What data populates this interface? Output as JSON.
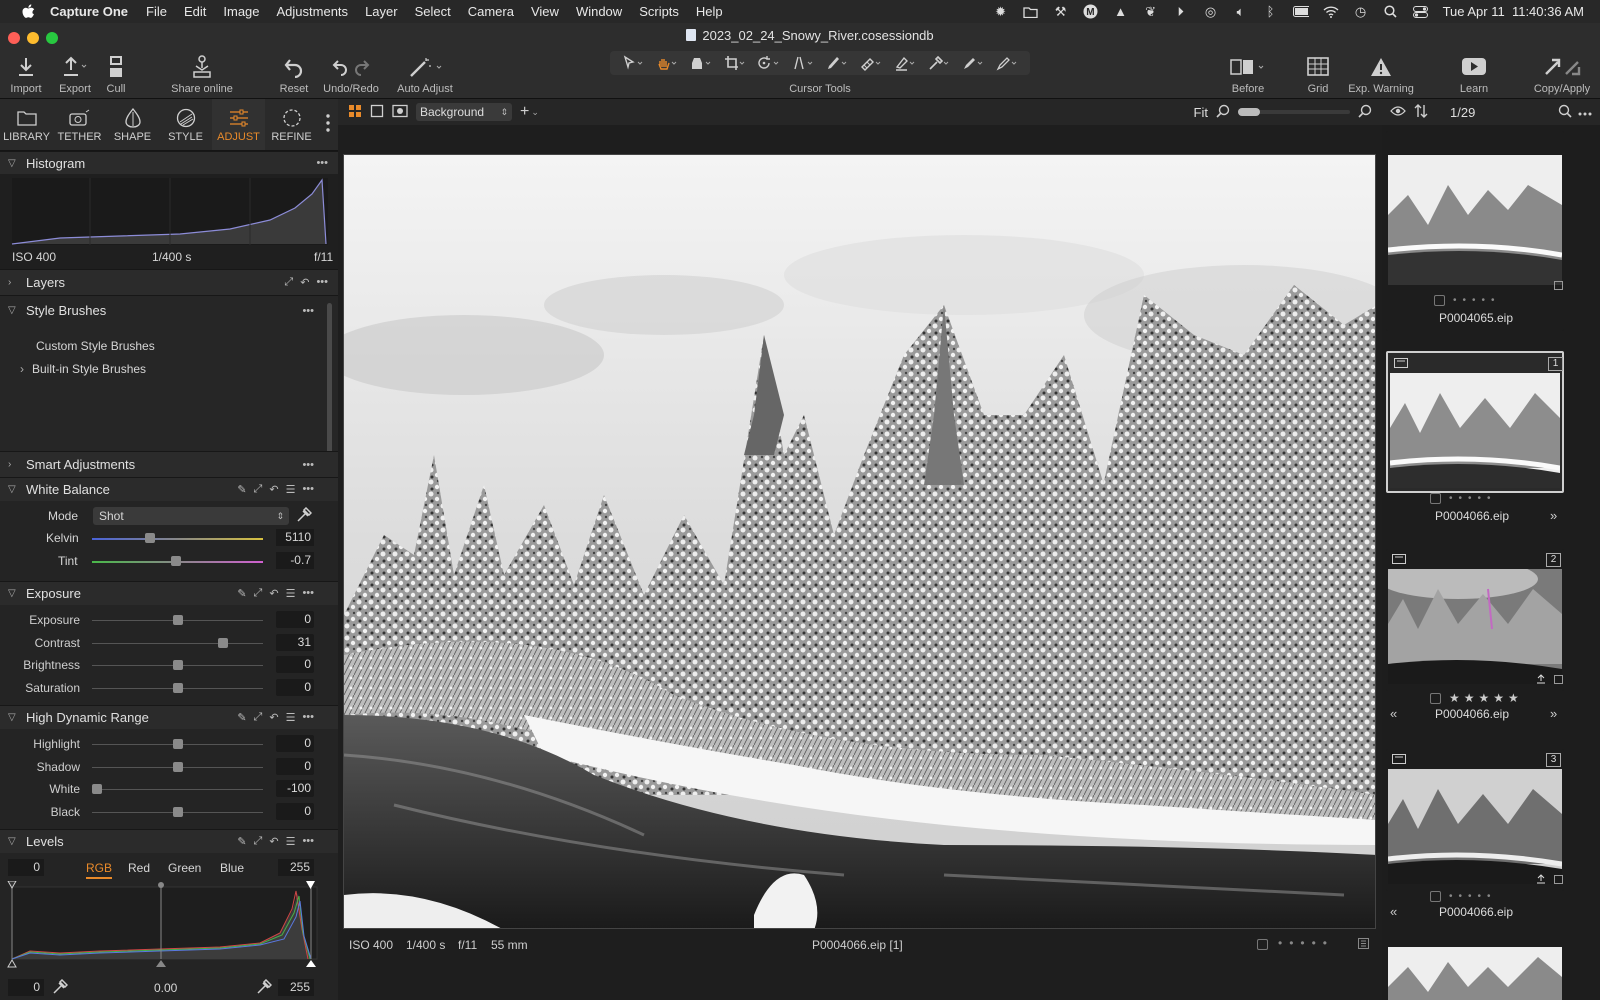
{
  "menubar": {
    "app": "Capture One",
    "items": [
      "File",
      "Edit",
      "Image",
      "Adjustments",
      "Layer",
      "Select",
      "Camera",
      "View",
      "Window",
      "Scripts",
      "Help"
    ],
    "datetime": "Tue Apr 11  11:40:36 AM"
  },
  "window": {
    "title": "2023_02_24_Snowy_River.cosessiondb"
  },
  "toolbar": {
    "import": "Import",
    "export": "Export",
    "cull": "Cull",
    "share": "Share online",
    "reset": "Reset",
    "undo_redo": "Undo/Redo",
    "auto_adjust": "Auto Adjust",
    "cursor_tools": "Cursor Tools",
    "before": "Before",
    "grid": "Grid",
    "exp_warning": "Exp. Warning",
    "learn": "Learn",
    "copy_apply": "Copy/Apply"
  },
  "tool_tabs": [
    "LIBRARY",
    "TETHER",
    "SHAPE",
    "STYLE",
    "ADJUST",
    "REFINE"
  ],
  "histogram": {
    "title": "Histogram",
    "iso": "ISO 400",
    "shutter": "1/400 s",
    "aperture": "f/11"
  },
  "layers": {
    "title": "Layers"
  },
  "style_brushes": {
    "title": "Style Brushes",
    "custom": "Custom Style Brushes",
    "builtin": "Built-in Style Brushes"
  },
  "smart_adjustments": {
    "title": "Smart Adjustments"
  },
  "white_balance": {
    "title": "White Balance",
    "mode_label": "Mode",
    "mode_value": "Shot",
    "kelvin_label": "Kelvin",
    "kelvin_value": "5110",
    "tint_label": "Tint",
    "tint_value": "-0.7"
  },
  "exposure": {
    "title": "Exposure",
    "rows": [
      {
        "label": "Exposure",
        "value": "0",
        "level": 0.5
      },
      {
        "label": "Contrast",
        "value": "31",
        "level": 0.78
      },
      {
        "label": "Brightness",
        "value": "0",
        "level": 0.5
      },
      {
        "label": "Saturation",
        "value": "0",
        "level": 0.5
      }
    ]
  },
  "hdr": {
    "title": "High Dynamic Range",
    "rows": [
      {
        "label": "Highlight",
        "value": "0",
        "level": 0.5
      },
      {
        "label": "Shadow",
        "value": "0",
        "level": 0.5
      },
      {
        "label": "White",
        "value": "-100",
        "level": 0.0
      },
      {
        "label": "Black",
        "value": "0",
        "level": 0.5
      }
    ]
  },
  "levels": {
    "title": "Levels",
    "low": "0",
    "high": "255",
    "tabs": [
      "RGB",
      "Red",
      "Green",
      "Blue"
    ],
    "out_low": "0",
    "mid": "0.00",
    "out_high": "255"
  },
  "viewer": {
    "layer": "Background",
    "fit": "Fit",
    "iso": "ISO 400",
    "shutter": "1/400 s",
    "aperture": "f/11",
    "focal": "55 mm",
    "filename": "P0004066.eip [1]"
  },
  "browser": {
    "count": "1/29",
    "thumbs": [
      {
        "name": "P0004065.eip"
      },
      {
        "name": "P0004066.eip",
        "badge": "1"
      },
      {
        "name": "P0004066.eip",
        "badge": "2"
      },
      {
        "name": "P0004066.eip",
        "badge": "3"
      }
    ]
  },
  "colors": {
    "accent": "#e98a2a",
    "panel": "#242424"
  }
}
